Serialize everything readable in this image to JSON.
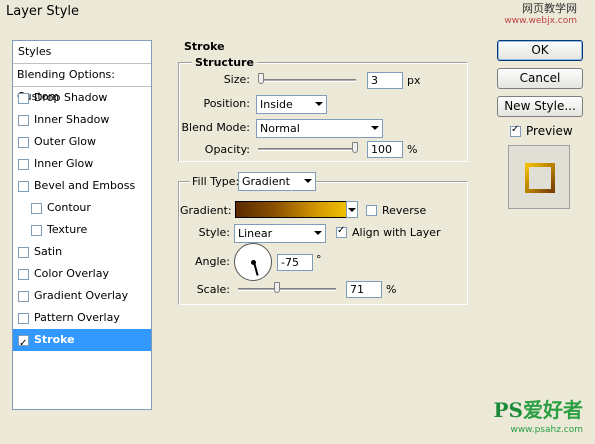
{
  "window": {
    "title": "Layer Style"
  },
  "watermark_top": {
    "line1": "网页教学网",
    "line2": "www.webjx.com"
  },
  "watermark_bottom": {
    "brand": "PS",
    "text": "爱好者",
    "site": "www.psahz.com"
  },
  "styles": {
    "header": "Styles",
    "blending": "Blending Options: Custom",
    "items": [
      {
        "label": "Drop Shadow",
        "checked": false
      },
      {
        "label": "Inner Shadow",
        "checked": false
      },
      {
        "label": "Outer Glow",
        "checked": false
      },
      {
        "label": "Inner Glow",
        "checked": false
      },
      {
        "label": "Bevel and Emboss",
        "checked": false
      },
      {
        "label": "Contour",
        "checked": false
      },
      {
        "label": "Texture",
        "checked": false
      },
      {
        "label": "Satin",
        "checked": false
      },
      {
        "label": "Color Overlay",
        "checked": false
      },
      {
        "label": "Gradient Overlay",
        "checked": false
      },
      {
        "label": "Pattern Overlay",
        "checked": false
      },
      {
        "label": "Stroke",
        "checked": true
      }
    ]
  },
  "stroke": {
    "title": "Stroke",
    "structure": {
      "title": "Structure",
      "size_label": "Size:",
      "size_value": "3",
      "size_unit": "px",
      "position_label": "Position:",
      "position_value": "Inside",
      "blend_label": "Blend Mode:",
      "blend_value": "Normal",
      "opacity_label": "Opacity:",
      "opacity_value": "100",
      "opacity_unit": "%"
    },
    "fill": {
      "type_label": "Fill Type:",
      "type_value": "Gradient",
      "gradient_label": "Gradient:",
      "reverse_label": "Reverse",
      "reverse_checked": false,
      "style_label": "Style:",
      "style_value": "Linear",
      "align_label": "Align with Layer",
      "align_checked": true,
      "angle_label": "Angle:",
      "angle_value": "-75",
      "angle_unit": "°",
      "scale_label": "Scale:",
      "scale_value": "71",
      "scale_unit": "%"
    }
  },
  "buttons": {
    "ok": "OK",
    "cancel": "Cancel",
    "new_style": "New Style...",
    "preview": "Preview"
  },
  "preview_checked": true
}
